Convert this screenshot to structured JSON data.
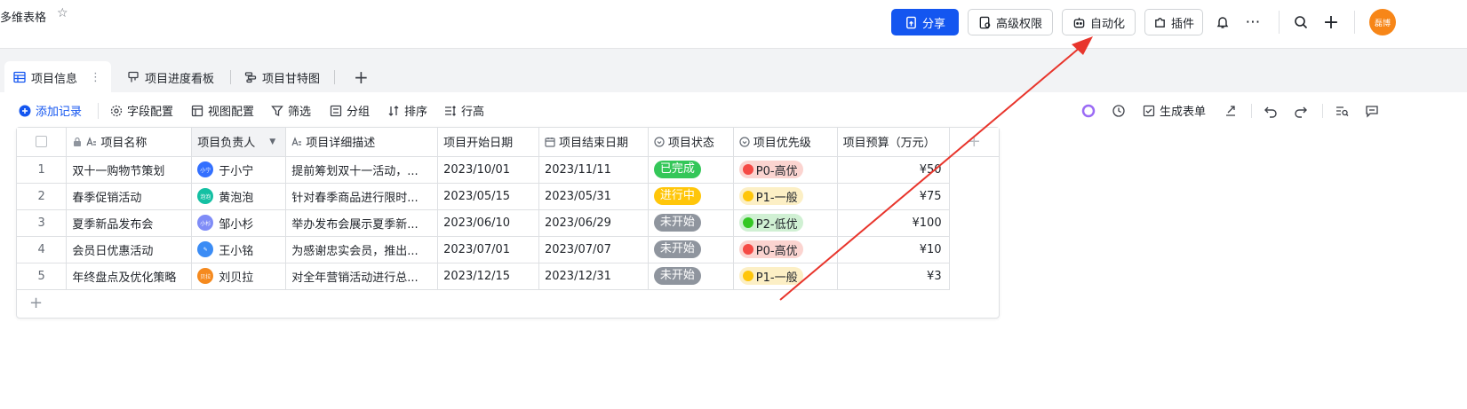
{
  "header": {
    "doc_title": "多维表格",
    "star_icon": "star-outline-icon",
    "share_label": "分享",
    "permission_label": "高级权限",
    "automation_label": "自动化",
    "plugin_label": "插件",
    "user_avatar_text": "磊博"
  },
  "tabs": [
    {
      "label": "项目信息",
      "icon": "grid-view-icon"
    },
    {
      "label": "项目进度看板",
      "icon": "kanban-icon"
    },
    {
      "label": "项目甘特图",
      "icon": "gantt-icon"
    }
  ],
  "toolbar": {
    "add_record": "添加记录",
    "field_config": "字段配置",
    "view_config": "视图配置",
    "filter": "筛选",
    "group": "分组",
    "sort": "排序",
    "row_height": "行高",
    "generate_form": "生成表单"
  },
  "table": {
    "columns": [
      "项目名称",
      "项目负责人",
      "项目详细描述",
      "项目开始日期",
      "项目结束日期",
      "项目状态",
      "项目优先级",
      "项目预算（万元）"
    ],
    "rows": [
      {
        "num": "1",
        "name": "双十一购物节策划",
        "owner": "于小宁",
        "owner_avatar": "小宁",
        "owner_color": "#3370ff",
        "desc": "提前筹划双十一活动，...",
        "start": "2023/10/01",
        "end": "2023/11/11",
        "status": "已完成",
        "status_color": "#34c759",
        "prio": "P0-高优",
        "prio_bg": "#fbd4d0",
        "prio_dot": "#f54a45",
        "budget": "¥50"
      },
      {
        "num": "2",
        "name": "春季促销活动",
        "owner": "黄泡泡",
        "owner_avatar": "泡泡",
        "owner_color": "#14c0a3",
        "desc": "针对春季商品进行限时...",
        "start": "2023/05/15",
        "end": "2023/05/31",
        "status": "进行中",
        "status_color": "#ffc60a",
        "prio": "P1-一般",
        "prio_bg": "#fcefc5",
        "prio_dot": "#ffc60a",
        "budget": "¥75"
      },
      {
        "num": "3",
        "name": "夏季新品发布会",
        "owner": "邹小杉",
        "owner_avatar": "小杉",
        "owner_color": "#7f8cf7",
        "desc": "举办发布会展示夏季新...",
        "start": "2023/06/10",
        "end": "2023/06/29",
        "status": "未开始",
        "status_color": "#8f959e",
        "prio": "P2-低优",
        "prio_bg": "#d0f0d3",
        "prio_dot": "#34c724",
        "budget": "¥100"
      },
      {
        "num": "4",
        "name": "会员日优惠活动",
        "owner": "王小铭",
        "owner_avatar": "✎",
        "owner_color": "#3b8cf5",
        "desc": "为感谢忠实会员，推出...",
        "start": "2023/07/01",
        "end": "2023/07/07",
        "status": "未开始",
        "status_color": "#8f959e",
        "prio": "P0-高优",
        "prio_bg": "#fbd4d0",
        "prio_dot": "#f54a45",
        "budget": "¥10"
      },
      {
        "num": "5",
        "name": "年终盘点及优化策略",
        "owner": "刘贝拉",
        "owner_avatar": "贝拉",
        "owner_color": "#f58a1f",
        "desc": "对全年营销活动进行总...",
        "start": "2023/12/15",
        "end": "2023/12/31",
        "status": "未开始",
        "status_color": "#8f959e",
        "prio": "P1-一般",
        "prio_bg": "#fcefc5",
        "prio_dot": "#ffc60a",
        "budget": "¥3"
      }
    ]
  },
  "annotation": {
    "color": "#e8352c"
  }
}
